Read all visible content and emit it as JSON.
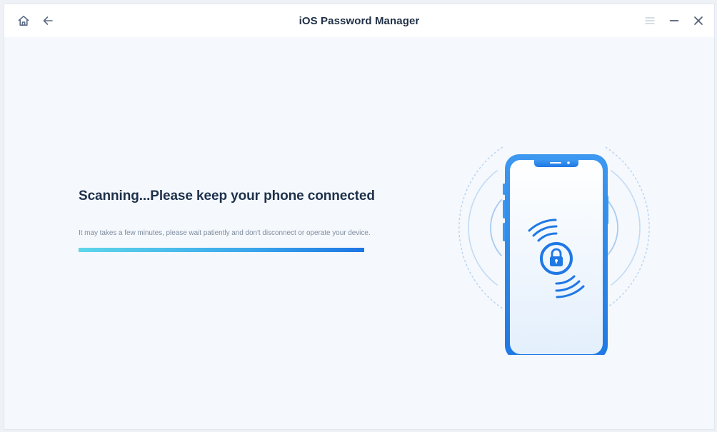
{
  "window": {
    "title": "iOS Password Manager"
  },
  "titlebar": {
    "home_icon": "home-icon",
    "back_icon": "arrow-left-icon",
    "menu_icon": "hamburger-menu-icon",
    "minimize_icon": "minimize-icon",
    "close_icon": "close-icon"
  },
  "scan": {
    "headline": "Scanning...Please keep your phone connected",
    "subtext": "It may takes a few minutes, please wait patiently and don't disconnect or operate your device.",
    "progress_fraction": 1.0
  },
  "illustration": {
    "phone_icon": "phone-icon",
    "lock_icon": "lock-icon",
    "cable_icon": "usb-cable-icon"
  },
  "colors": {
    "accent": "#1d76e3",
    "progress_start": "#5ed6ea",
    "progress_end": "#1d76e3",
    "headline": "#1e314b",
    "subtext": "#7f8da0",
    "background": "#f5f8fc"
  }
}
